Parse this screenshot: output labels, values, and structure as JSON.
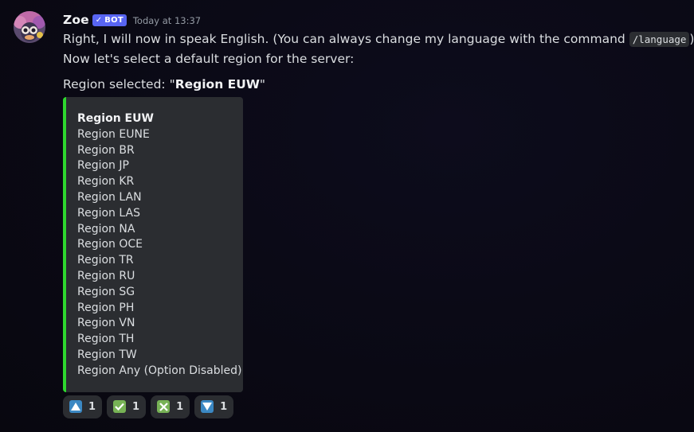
{
  "message": {
    "username": "Zoe",
    "bot_tag": "BOT",
    "bot_check": "✓",
    "timestamp": "Today at 13:37",
    "line1_before": "Right, I will now in speak English. (You can always change my language with the command ",
    "line1_code": "/language",
    "line1_after": ").",
    "line2": "Now let's select a default region for the server:",
    "region_selected_prefix": "Region selected: \"",
    "region_selected_value": "Region EUW",
    "region_selected_suffix": "\""
  },
  "embed": {
    "accent_color": "#2ed82e",
    "items": [
      "Region EUW",
      "Region EUNE",
      "Region BR",
      "Region JP",
      "Region KR",
      "Region LAN",
      "Region LAS",
      "Region NA",
      "Region OCE",
      "Region TR",
      "Region RU",
      "Region SG",
      "Region PH",
      "Region VN",
      "Region TH",
      "Region TW",
      "Region Any (Option Disabled)"
    ]
  },
  "reactions": [
    {
      "icon": "arrow-up-icon",
      "color": "#3b88c3",
      "count": "1"
    },
    {
      "icon": "check-mark-icon",
      "color": "#77b255",
      "count": "1"
    },
    {
      "icon": "cross-mark-icon",
      "color": "#77b255",
      "count": "1"
    },
    {
      "icon": "arrow-down-icon",
      "color": "#3b88c3",
      "count": "1"
    }
  ]
}
